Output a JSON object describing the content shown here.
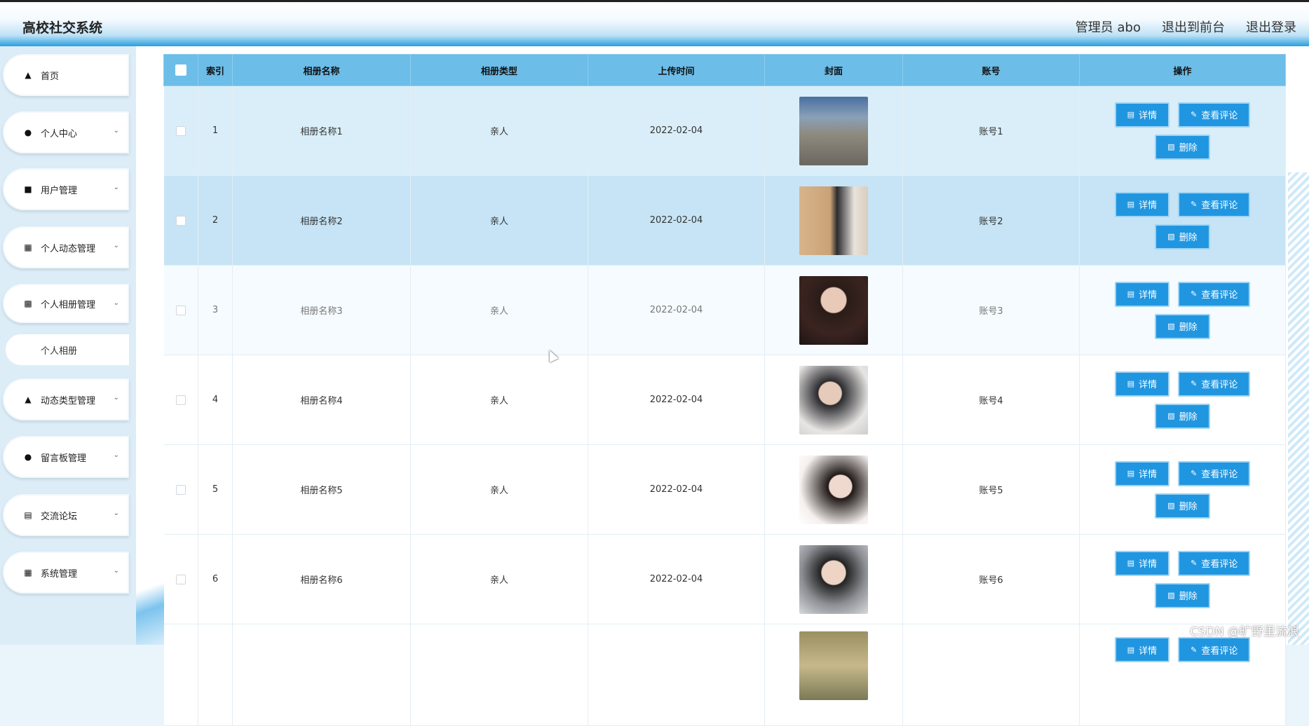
{
  "header": {
    "title": "高校社交系统",
    "admin": "管理员 abo",
    "to_front": "退出到前台",
    "logout": "退出登录"
  },
  "sidebar": {
    "items": [
      {
        "label": "首页",
        "icon": "home-icon"
      },
      {
        "label": "个人中心",
        "icon": "user-icon"
      },
      {
        "label": "用户管理",
        "icon": "monitor-icon"
      },
      {
        "label": "个人动态管理",
        "icon": "grid-icon"
      },
      {
        "label": "个人相册管理",
        "icon": "briefcase-icon"
      },
      {
        "label": "动态类型管理",
        "icon": "ticket-icon"
      },
      {
        "label": "留言板管理",
        "icon": "user-icon"
      },
      {
        "label": "交流论坛",
        "icon": "clipboard-icon"
      },
      {
        "label": "系统管理",
        "icon": "grid-icon"
      }
    ],
    "sub_item": "个人相册"
  },
  "table": {
    "headers": [
      "索引",
      "相册名称",
      "相册类型",
      "上传时间",
      "封面",
      "账号",
      "操作"
    ],
    "rows": [
      {
        "index": "1",
        "name": "相册名称1",
        "type": "亲人",
        "time": "2022-02-04",
        "account": "账号1"
      },
      {
        "index": "2",
        "name": "相册名称2",
        "type": "亲人",
        "time": "2022-02-04",
        "account": "账号2"
      },
      {
        "index": "3",
        "name": "相册名称3",
        "type": "亲人",
        "time": "2022-02-04",
        "account": "账号3"
      },
      {
        "index": "4",
        "name": "相册名称4",
        "type": "亲人",
        "time": "2022-02-04",
        "account": "账号4"
      },
      {
        "index": "5",
        "name": "相册名称5",
        "type": "亲人",
        "time": "2022-02-04",
        "account": "账号5"
      },
      {
        "index": "6",
        "name": "相册名称6",
        "type": "亲人",
        "time": "2022-02-04",
        "account": "账号6"
      }
    ],
    "actions": {
      "detail": "详情",
      "comments": "查看评论",
      "delete": "删除"
    }
  },
  "watermark": "CSDN @旷野里流浪"
}
